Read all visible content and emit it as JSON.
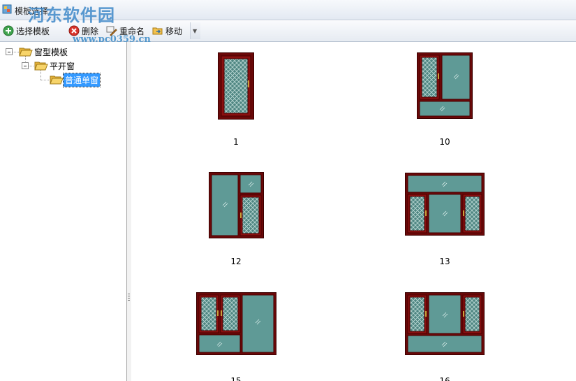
{
  "window": {
    "title": "模板选择"
  },
  "watermark": {
    "site": "河东软件园",
    "url": "www.pc0359.cn"
  },
  "toolbar": {
    "add_label": "选择模板",
    "delete_label": "删除",
    "rename_label": "重命名",
    "move_label": "移动"
  },
  "tree": {
    "root": {
      "label": "窗型模板"
    },
    "child": {
      "label": "平开窗"
    },
    "leaf": {
      "label": "普通单窗",
      "selected": true
    }
  },
  "gallery": {
    "items": [
      {
        "label": "1",
        "design": "single-mesh"
      },
      {
        "label": "10",
        "design": "mesh-glass-top-transom-bottom"
      },
      {
        "label": "12",
        "design": "glass-left-top-glass-bottom-mesh-right"
      },
      {
        "label": "13",
        "design": "top-transom-three-sash"
      },
      {
        "label": "15",
        "design": "two-mesh-plus-glass-bottom-transom"
      },
      {
        "label": "16",
        "design": "mesh-glass-mesh-bottom-transom"
      }
    ]
  },
  "colors": {
    "frame": "#7a0a0a",
    "glass": "#5f9a96",
    "mesh_bg": "#4f8682",
    "handle": "#c9a23a",
    "selection": "#3399ff"
  }
}
